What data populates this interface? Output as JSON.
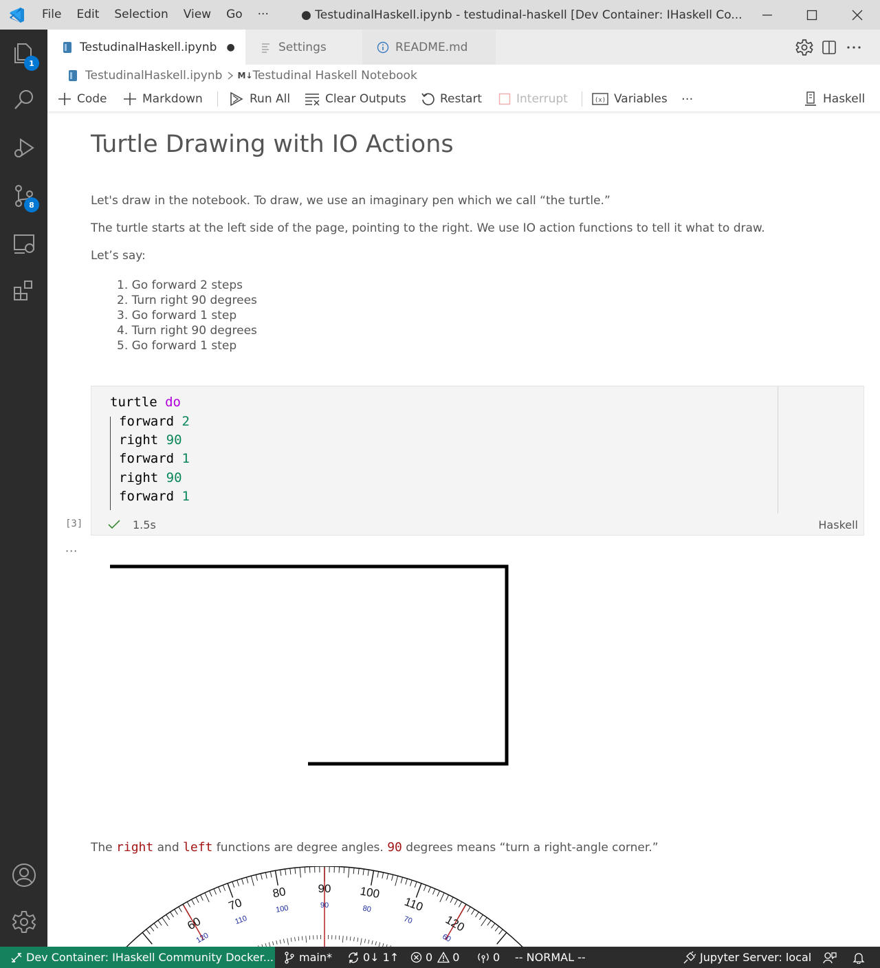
{
  "titlebar": {
    "menus": [
      "File",
      "Edit",
      "Selection",
      "View",
      "Go",
      "···"
    ],
    "title": "● TestudinalHaskell.ipynb - testudinal-haskell [Dev Container: IHaskell Co..."
  },
  "activity": {
    "explorer_badge": "1",
    "scm_badge": "8"
  },
  "tabs": [
    {
      "label": "TestudinalHaskell.ipynb",
      "icon": "notebook-icon",
      "dirty": "●"
    },
    {
      "label": "Settings",
      "icon": "settings-file-icon"
    },
    {
      "label": "README.md",
      "icon": "info-icon"
    }
  ],
  "breadcrumb": {
    "file": "TestudinalHaskell.ipynb",
    "md_prefix": "M↓",
    "section": "Testudinal Haskell Notebook"
  },
  "toolbar": {
    "code": "Code",
    "markdown": "Markdown",
    "run_all": "Run All",
    "clear_outputs": "Clear Outputs",
    "restart": "Restart",
    "interrupt": "Interrupt",
    "variables": "Variables",
    "more": "···",
    "kernel": "Haskell"
  },
  "notebook": {
    "heading": "Turtle Drawing with IO Actions",
    "para1": "Let's draw in the notebook. To draw, we use an imaginary pen which we call “the turtle.”",
    "para2": "The turtle starts at the left side of the page, pointing to the right. We use IO action functions to tell it what to draw.",
    "para3": "Let’s say:",
    "steps": [
      "1. Go forward 2 steps",
      "2. Turn right 90 degrees",
      "3. Go forward 1 step",
      "4. Turn right 90 degrees",
      "5. Go forward 1 step"
    ],
    "code": {
      "l1a": "turtle ",
      "l1b": "do",
      "l2a": "forward ",
      "l2b": "2",
      "l3a": "right ",
      "l3b": "90",
      "l4a": "forward ",
      "l4b": "1",
      "l5a": "right ",
      "l5b": "90",
      "l6a": "forward ",
      "l6b": "1"
    },
    "exec_count": "[3]",
    "exec_time": "1.5s",
    "cell_lang": "Haskell",
    "output_more": "···",
    "p4_a": "The ",
    "p4_right": "right",
    "p4_b": " and ",
    "p4_left": "left",
    "p4_c": " functions are degree angles. ",
    "p4_90": "90",
    "p4_d": " degrees means “turn a right-angle corner.”",
    "protractor_outer": [
      "60",
      "70",
      "80",
      "90",
      "100",
      "110",
      "120"
    ],
    "protractor_inner": [
      "120",
      "110",
      "100",
      "90",
      "80",
      "70",
      "60"
    ]
  },
  "statusbar": {
    "remote": "Dev Container: IHaskell Community Docker...",
    "branch": "main*",
    "sync": "0↓ 1↑",
    "errors": "0",
    "warnings": "0",
    "ports": "0",
    "mode": "-- NORMAL --",
    "jupyter": "Jupyter Server: local"
  },
  "colors": {
    "activitybar": "#2c2c2c",
    "remote": "#16825d",
    "accent": "#0078d4",
    "keyword": "#af00db",
    "number": "#098658",
    "inline_code": "#a31515"
  }
}
